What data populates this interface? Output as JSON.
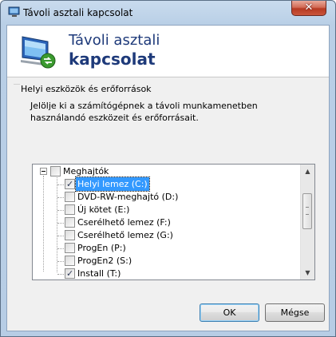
{
  "window": {
    "title": "Távoli asztali kapcsolat",
    "close_glyph": "✕"
  },
  "banner": {
    "line1": "Távoli asztali",
    "line2": "kapcsolat",
    "icon": "remote-desktop-icon"
  },
  "group": {
    "title": "Helyi eszközök és erőforrások",
    "description": "Jelölje ki a számítógépnek a távoli munkamenetben használandó eszközeit és erőforrásait."
  },
  "tree": {
    "root": {
      "label": "Meghajtók",
      "checked": false,
      "expanded": true
    },
    "items": [
      {
        "label": "Helyi lemez (C:)",
        "checked": true,
        "selected": true
      },
      {
        "label": "DVD-RW-meghajtó (D:)",
        "checked": false,
        "selected": false
      },
      {
        "label": "Új kötet (E:)",
        "checked": false,
        "selected": false
      },
      {
        "label": "Cserélhető lemez (F:)",
        "checked": false,
        "selected": false
      },
      {
        "label": "Cserélhető lemez (G:)",
        "checked": false,
        "selected": false
      },
      {
        "label": "ProgEn (P:)",
        "checked": false,
        "selected": false
      },
      {
        "label": "ProgEn2 (S:)",
        "checked": false,
        "selected": false
      },
      {
        "label": "Install (T:)",
        "checked": true,
        "selected": false
      }
    ],
    "scroll_up_glyph": "▲",
    "scroll_down_glyph": "▼"
  },
  "buttons": {
    "ok": "OK",
    "cancel": "Mégse"
  },
  "colors": {
    "banner_text": "#1e3a7a",
    "selection": "#3399ff"
  }
}
